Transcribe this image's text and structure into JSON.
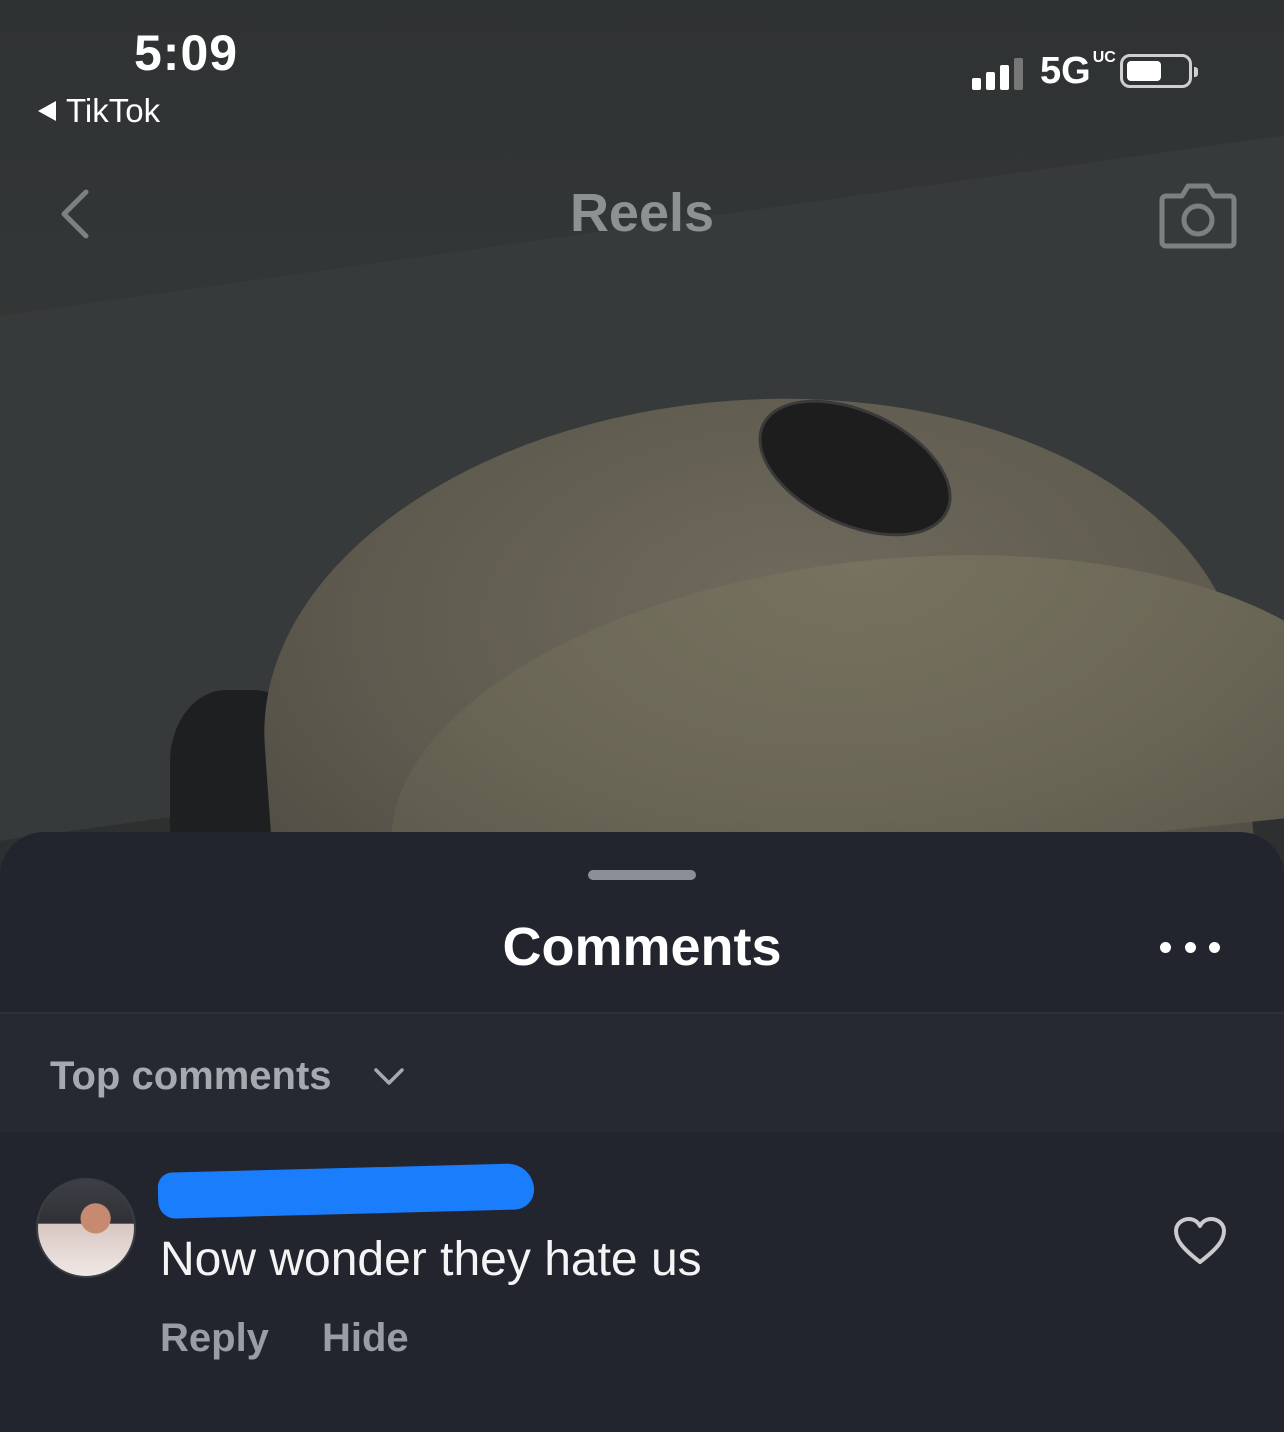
{
  "status_bar": {
    "time": "5:09",
    "back_app": "TikTok",
    "network": "5G",
    "network_badge": "UC"
  },
  "header": {
    "title": "Reels"
  },
  "comments_sheet": {
    "title": "Comments",
    "sort_label": "Top comments",
    "comments": [
      {
        "text": "Now wonder they hate us",
        "reply_label": "Reply",
        "hide_label": "Hide"
      }
    ]
  },
  "colors": {
    "sheet_background": "#22252d",
    "redaction": "#1a7dfb"
  }
}
